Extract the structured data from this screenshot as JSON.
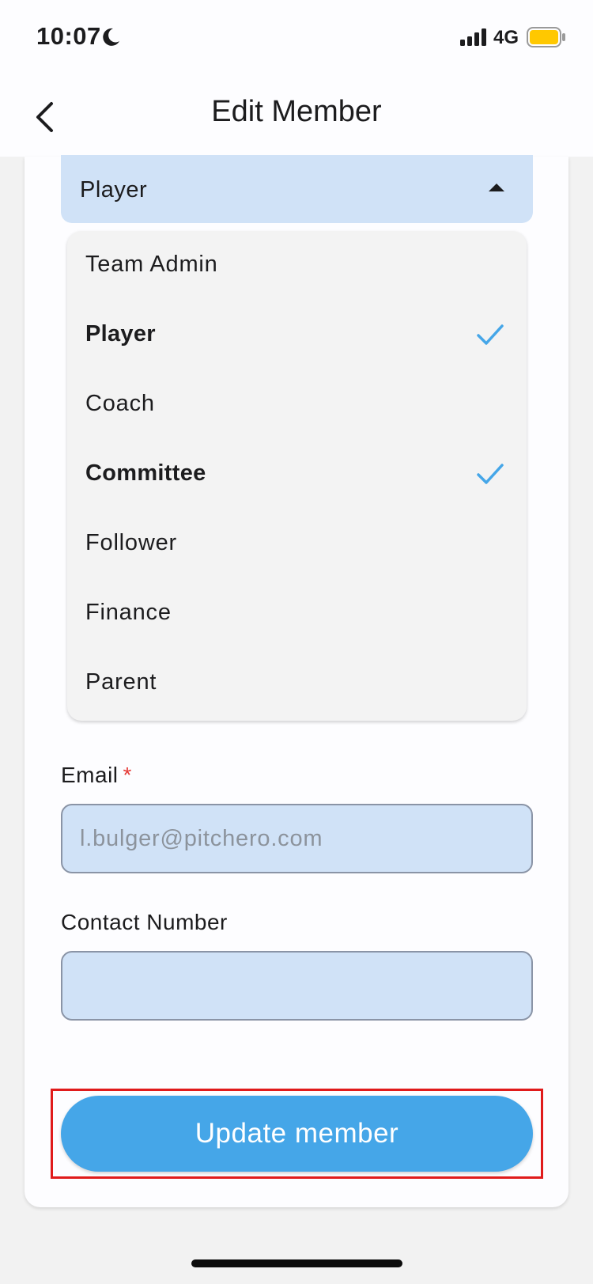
{
  "status_bar": {
    "time": "10:07",
    "network": "4G",
    "icons": [
      "moon-icon",
      "signal-icon",
      "battery-icon"
    ],
    "battery_color": "#ffc800"
  },
  "nav": {
    "title": "Edit Member",
    "back_icon": "chevron-left-icon"
  },
  "role_select": {
    "value": "Player",
    "expanded": true,
    "icon": "caret-up-icon",
    "background": "#d0e2f7"
  },
  "role_options": [
    {
      "label": "Team Admin",
      "selected": false
    },
    {
      "label": "Player",
      "selected": true
    },
    {
      "label": "Coach",
      "selected": false
    },
    {
      "label": "Committee",
      "selected": true
    },
    {
      "label": "Follower",
      "selected": false
    },
    {
      "label": "Finance",
      "selected": false
    },
    {
      "label": "Parent",
      "selected": false
    }
  ],
  "email": {
    "label": "Email",
    "required_mark": "*",
    "value": "",
    "placeholder": "l.bulger@pitchero.com"
  },
  "contact": {
    "label": "Contact Number",
    "value": "",
    "placeholder": ""
  },
  "update_button": {
    "label": "Update member",
    "color": "#45a6e8",
    "highlight_color": "#e01b1b"
  },
  "colors": {
    "check": "#45a6e8",
    "required": "#e53935"
  }
}
